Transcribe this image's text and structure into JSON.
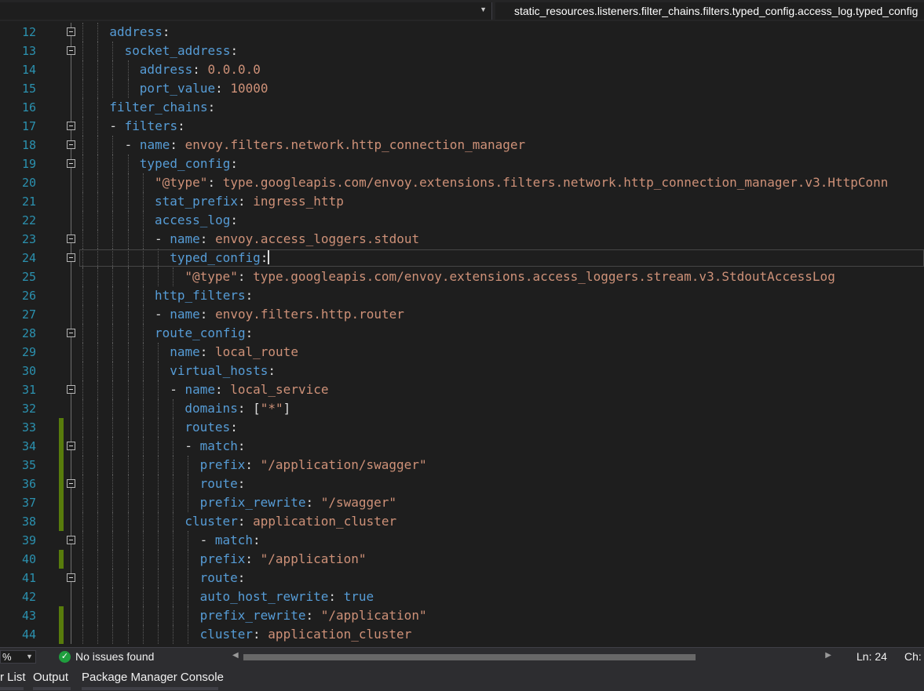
{
  "navbar": {
    "dropdown_icon": "chevron-down-icon",
    "breadcrumb": "static_resources.listeners.filter_chains.filters.typed_config.access_log.typed_config"
  },
  "editor": {
    "cursor_line": 24,
    "lines": [
      {
        "n": "12",
        "c": [
          [
            "k",
            "address"
          ],
          [
            "p",
            ":"
          ]
        ]
      },
      {
        "n": "13",
        "c": [
          [
            "k",
            "socket_address"
          ],
          [
            "p",
            ":"
          ]
        ]
      },
      {
        "n": "14",
        "c": [
          [
            "k",
            "address"
          ],
          [
            "p",
            ": "
          ],
          [
            "v",
            "0.0.0.0"
          ]
        ]
      },
      {
        "n": "15",
        "c": [
          [
            "k",
            "port_value"
          ],
          [
            "p",
            ": "
          ],
          [
            "v",
            "10000"
          ]
        ]
      },
      {
        "n": "16",
        "c": [
          [
            "k",
            "filter_chains"
          ],
          [
            "p",
            ":"
          ]
        ]
      },
      {
        "n": "17",
        "c": [
          [
            "p",
            "- "
          ],
          [
            "k",
            "filters"
          ],
          [
            "p",
            ":"
          ]
        ]
      },
      {
        "n": "18",
        "c": [
          [
            "p",
            "- "
          ],
          [
            "k",
            "name"
          ],
          [
            "p",
            ": "
          ],
          [
            "v",
            "envoy.filters.network.http_connection_manager"
          ]
        ]
      },
      {
        "n": "19",
        "c": [
          [
            "k",
            "typed_config"
          ],
          [
            "p",
            ":"
          ]
        ]
      },
      {
        "n": "20",
        "c": [
          [
            "v",
            "\"@type\""
          ],
          [
            "p",
            ": "
          ],
          [
            "v",
            "type.googleapis.com/envoy.extensions.filters.network.http_connection_manager.v3.HttpConn"
          ]
        ]
      },
      {
        "n": "21",
        "c": [
          [
            "k",
            "stat_prefix"
          ],
          [
            "p",
            ": "
          ],
          [
            "v",
            "ingress_http"
          ]
        ]
      },
      {
        "n": "22",
        "c": [
          [
            "k",
            "access_log"
          ],
          [
            "p",
            ":"
          ]
        ]
      },
      {
        "n": "23",
        "c": [
          [
            "p",
            "- "
          ],
          [
            "k",
            "name"
          ],
          [
            "p",
            ": "
          ],
          [
            "v",
            "envoy.access_loggers.stdout"
          ]
        ]
      },
      {
        "n": "24",
        "c": [
          [
            "k",
            "typed_config"
          ],
          [
            "p",
            ":"
          ]
        ]
      },
      {
        "n": "25",
        "c": [
          [
            "v",
            "\"@type\""
          ],
          [
            "p",
            ": "
          ],
          [
            "v",
            "type.googleapis.com/envoy.extensions.access_loggers.stream.v3.StdoutAccessLog"
          ]
        ]
      },
      {
        "n": "26",
        "c": [
          [
            "k",
            "http_filters"
          ],
          [
            "p",
            ":"
          ]
        ]
      },
      {
        "n": "27",
        "c": [
          [
            "p",
            "- "
          ],
          [
            "k",
            "name"
          ],
          [
            "p",
            ": "
          ],
          [
            "v",
            "envoy.filters.http.router"
          ]
        ]
      },
      {
        "n": "28",
        "c": [
          [
            "k",
            "route_config"
          ],
          [
            "p",
            ":"
          ]
        ]
      },
      {
        "n": "29",
        "c": [
          [
            "k",
            "name"
          ],
          [
            "p",
            ": "
          ],
          [
            "v",
            "local_route"
          ]
        ]
      },
      {
        "n": "30",
        "c": [
          [
            "k",
            "virtual_hosts"
          ],
          [
            "p",
            ":"
          ]
        ]
      },
      {
        "n": "31",
        "c": [
          [
            "p",
            "- "
          ],
          [
            "k",
            "name"
          ],
          [
            "p",
            ": "
          ],
          [
            "v",
            "local_service"
          ]
        ]
      },
      {
        "n": "32",
        "c": [
          [
            "k",
            "domains"
          ],
          [
            "p",
            ": ["
          ],
          [
            "v",
            "\"*\""
          ],
          [
            "p",
            "]"
          ]
        ]
      },
      {
        "n": "33",
        "c": [
          [
            "k",
            "routes"
          ],
          [
            "p",
            ":"
          ]
        ]
      },
      {
        "n": "34",
        "c": [
          [
            "p",
            "- "
          ],
          [
            "k",
            "match"
          ],
          [
            "p",
            ":"
          ]
        ]
      },
      {
        "n": "35",
        "c": [
          [
            "k",
            "prefix"
          ],
          [
            "p",
            ": "
          ],
          [
            "v",
            "\"/application/swagger\""
          ]
        ]
      },
      {
        "n": "36",
        "c": [
          [
            "k",
            "route"
          ],
          [
            "p",
            ":"
          ]
        ]
      },
      {
        "n": "37",
        "c": [
          [
            "k",
            "prefix_rewrite"
          ],
          [
            "p",
            ": "
          ],
          [
            "v",
            "\"/swagger\""
          ]
        ]
      },
      {
        "n": "38",
        "c": [
          [
            "k",
            "cluster"
          ],
          [
            "p",
            ": "
          ],
          [
            "v",
            "application_cluster"
          ]
        ]
      },
      {
        "n": "39",
        "c": [
          [
            "p",
            "- "
          ],
          [
            "k",
            "match"
          ],
          [
            "p",
            ":"
          ]
        ]
      },
      {
        "n": "40",
        "c": [
          [
            "k",
            "prefix"
          ],
          [
            "p",
            ": "
          ],
          [
            "v",
            "\"/application\""
          ]
        ]
      },
      {
        "n": "41",
        "c": [
          [
            "k",
            "route"
          ],
          [
            "p",
            ":"
          ]
        ]
      },
      {
        "n": "42",
        "c": [
          [
            "k",
            "auto_host_rewrite"
          ],
          [
            "p",
            ": "
          ],
          [
            "t",
            "true"
          ]
        ]
      },
      {
        "n": "43",
        "c": [
          [
            "k",
            "prefix_rewrite"
          ],
          [
            "p",
            ": "
          ],
          [
            "v",
            "\"/application\""
          ]
        ]
      },
      {
        "n": "44",
        "c": [
          [
            "k",
            "cluster"
          ],
          [
            "p",
            ": "
          ],
          [
            "v",
            "application_cluster"
          ]
        ]
      }
    ],
    "changed_lines": [
      "33",
      "34",
      "35",
      "36",
      "37",
      "38",
      "40",
      "43",
      "44"
    ],
    "colors": {
      "key": "#569cd6",
      "value": "#ce9178",
      "punct": "#dcdcdc",
      "line_number": "#2b91af",
      "change_bar": "#587c0c"
    }
  },
  "status": {
    "zoom": "%",
    "zoom_icon": "chevron-down-icon",
    "issues_icon": "check-circle-icon",
    "issues": "No issues found",
    "ln": "Ln: 24",
    "ch": "Ch:"
  },
  "tool_tabs": [
    "r List",
    "Output",
    "Package Manager Console"
  ]
}
